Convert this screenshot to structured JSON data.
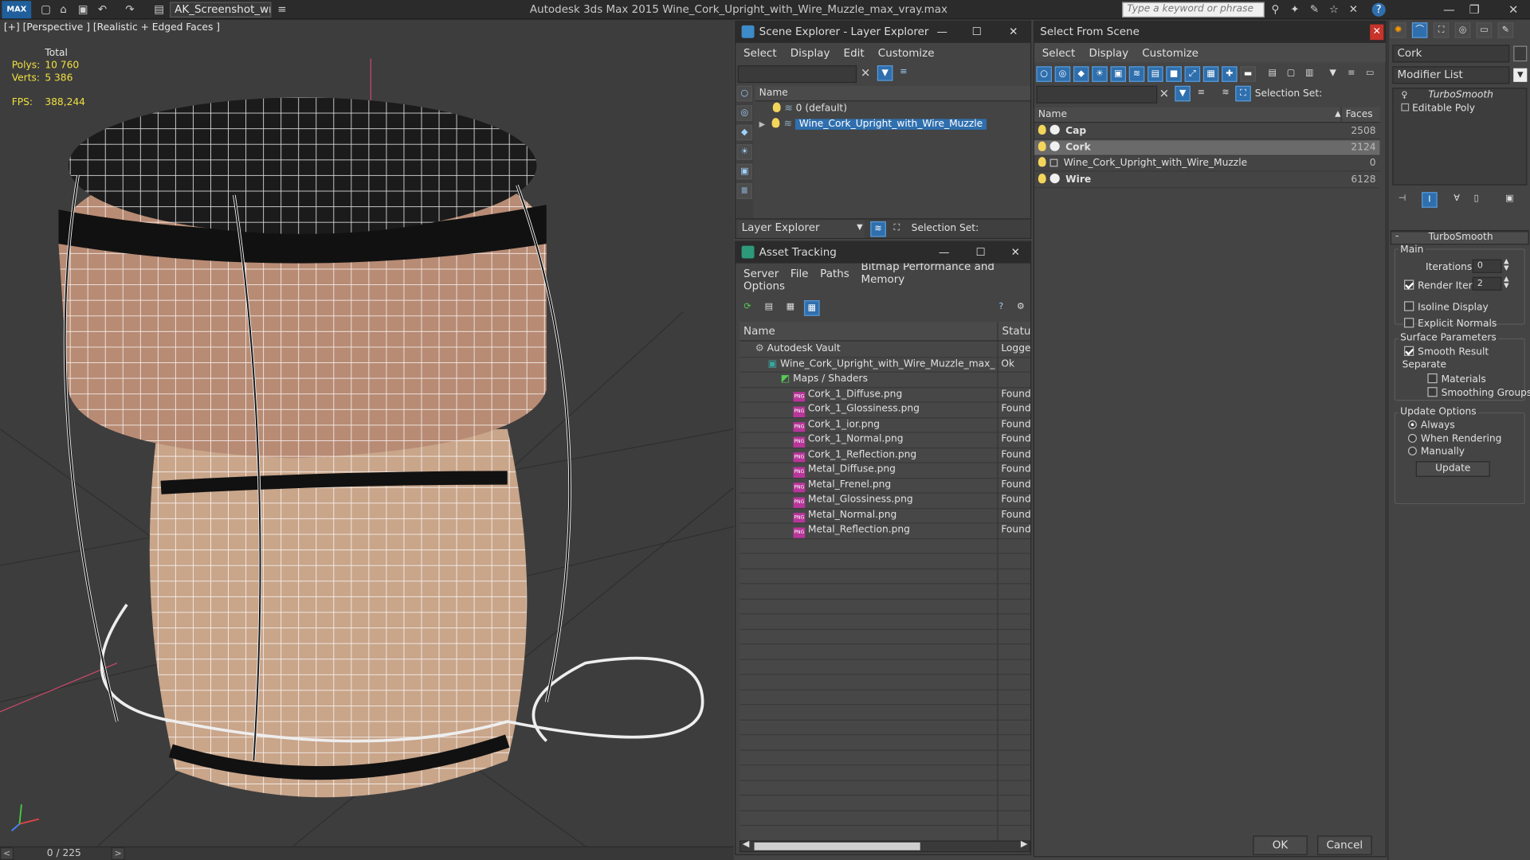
{
  "app": {
    "title": "Autodesk 3ds Max  2015     Wine_Cork_Upright_with_Wire_Muzzle_max_vray.max",
    "workspace": "AK_Screenshot_wrksp",
    "search_placeholder": "Type a keyword or phrase",
    "logo": "MAX"
  },
  "viewport": {
    "label": "[+] [Perspective ] [Realistic + Edged Faces ]",
    "stats": {
      "total_label": "Total",
      "polys_label": "Polys:",
      "polys_value": "10 760",
      "verts_label": "Verts:",
      "verts_value": "5 386",
      "fps_label": "FPS:",
      "fps_value": "388,244"
    }
  },
  "timeline": {
    "frame": "0 / 225",
    "prev": "<",
    "next": ">"
  },
  "scene_explorer": {
    "title": "Scene Explorer - Layer Explorer",
    "menu": [
      "Select",
      "Display",
      "Edit",
      "Customize"
    ],
    "column": "Name",
    "rows": [
      "0 (default)",
      "Wine_Cork_Upright_with_Wire_Muzzle"
    ],
    "footer_dropdown": "Layer Explorer",
    "selection_set": "Selection Set:"
  },
  "asset_tracking": {
    "title": "Asset Tracking",
    "menu": [
      "Server",
      "File",
      "Paths",
      "Bitmap Performance and Memory"
    ],
    "menu2": "Options",
    "col_name": "Name",
    "col_status": "Status",
    "rows": [
      {
        "name": "Autodesk Vault",
        "status": "Logged",
        "indent": 0,
        "icon": "vault"
      },
      {
        "name": "Wine_Cork_Upright_with_Wire_Muzzle_max_vra...",
        "status": "Ok",
        "indent": 1,
        "icon": "max"
      },
      {
        "name": "Maps / Shaders",
        "status": "",
        "indent": 2,
        "icon": "maps"
      },
      {
        "name": "Cork_1_Diffuse.png",
        "status": "Found",
        "indent": 3,
        "icon": "png"
      },
      {
        "name": "Cork_1_Glossiness.png",
        "status": "Found",
        "indent": 3,
        "icon": "png"
      },
      {
        "name": "Cork_1_ior.png",
        "status": "Found",
        "indent": 3,
        "icon": "png"
      },
      {
        "name": "Cork_1_Normal.png",
        "status": "Found",
        "indent": 3,
        "icon": "png"
      },
      {
        "name": "Cork_1_Reflection.png",
        "status": "Found",
        "indent": 3,
        "icon": "png"
      },
      {
        "name": "Metal_Diffuse.png",
        "status": "Found",
        "indent": 3,
        "icon": "png"
      },
      {
        "name": "Metal_Frenel.png",
        "status": "Found",
        "indent": 3,
        "icon": "png"
      },
      {
        "name": "Metal_Glossiness.png",
        "status": "Found",
        "indent": 3,
        "icon": "png"
      },
      {
        "name": "Metal_Normal.png",
        "status": "Found",
        "indent": 3,
        "icon": "png"
      },
      {
        "name": "Metal_Reflection.png",
        "status": "Found",
        "indent": 3,
        "icon": "png"
      }
    ],
    "png_badge": "PNG"
  },
  "select_from_scene": {
    "title": "Select From Scene",
    "menu": [
      "Select",
      "Display",
      "Customize"
    ],
    "selection_set": "Selection Set:",
    "col_name": "Name",
    "col_faces": "Faces",
    "rows": [
      {
        "name": "Cap",
        "faces": "2508",
        "selected": false,
        "bold": true
      },
      {
        "name": "Cork",
        "faces": "2124",
        "selected": true,
        "bold": true
      },
      {
        "name": "Wine_Cork_Upright_with_Wire_Muzzle",
        "faces": "0",
        "selected": false,
        "bold": false
      },
      {
        "name": "Wire",
        "faces": "6128",
        "selected": false,
        "bold": true
      }
    ],
    "ok": "OK",
    "cancel": "Cancel"
  },
  "command_panel": {
    "object_name": "Cork",
    "modifier_list": "Modifier List",
    "stack": [
      "TurboSmooth",
      "Editable Poly"
    ],
    "rollout": "TurboSmooth",
    "main_label": "Main",
    "iterations_label": "Iterations:",
    "iterations_value": "0",
    "render_iters_label": "Render Iters:",
    "render_iters_value": "2",
    "isoline": "Isoline Display",
    "explicit_normals": "Explicit Normals",
    "surface_params": "Surface Parameters",
    "smooth_result": "Smooth Result",
    "separate": "Separate",
    "materials": "Materials",
    "smoothing_groups": "Smoothing Groups",
    "update_options": "Update Options",
    "always": "Always",
    "when_rendering": "When Rendering",
    "manually": "Manually",
    "update_button": "Update",
    "collapse": "-"
  }
}
